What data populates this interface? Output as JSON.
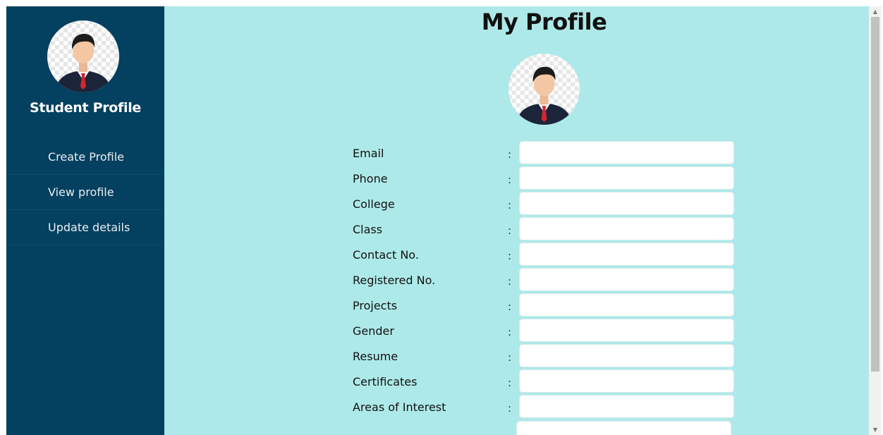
{
  "sidebar": {
    "title": "Student Profile",
    "nav": [
      {
        "label": "Create Profile"
      },
      {
        "label": "View profile"
      },
      {
        "label": "Update details"
      }
    ]
  },
  "main": {
    "title": "My Profile",
    "colon": ":",
    "fields": [
      {
        "label": "Email",
        "value": ""
      },
      {
        "label": "Phone",
        "value": ""
      },
      {
        "label": "College",
        "value": ""
      },
      {
        "label": "Class",
        "value": ""
      },
      {
        "label": "Contact No.",
        "value": ""
      },
      {
        "label": "Registered No.",
        "value": ""
      },
      {
        "label": "Projects",
        "value": ""
      },
      {
        "label": "Gender",
        "value": ""
      },
      {
        "label": "Resume",
        "value": ""
      },
      {
        "label": "Certificates",
        "value": ""
      },
      {
        "label": "Areas of Interest",
        "value": ""
      }
    ]
  },
  "colors": {
    "sidebar_bg": "#04405f",
    "main_bg": "#aee9e9"
  },
  "icons": {
    "avatar": "user-avatar-icon",
    "scroll_up": "scroll-up-arrow",
    "scroll_down": "scroll-down-arrow"
  }
}
